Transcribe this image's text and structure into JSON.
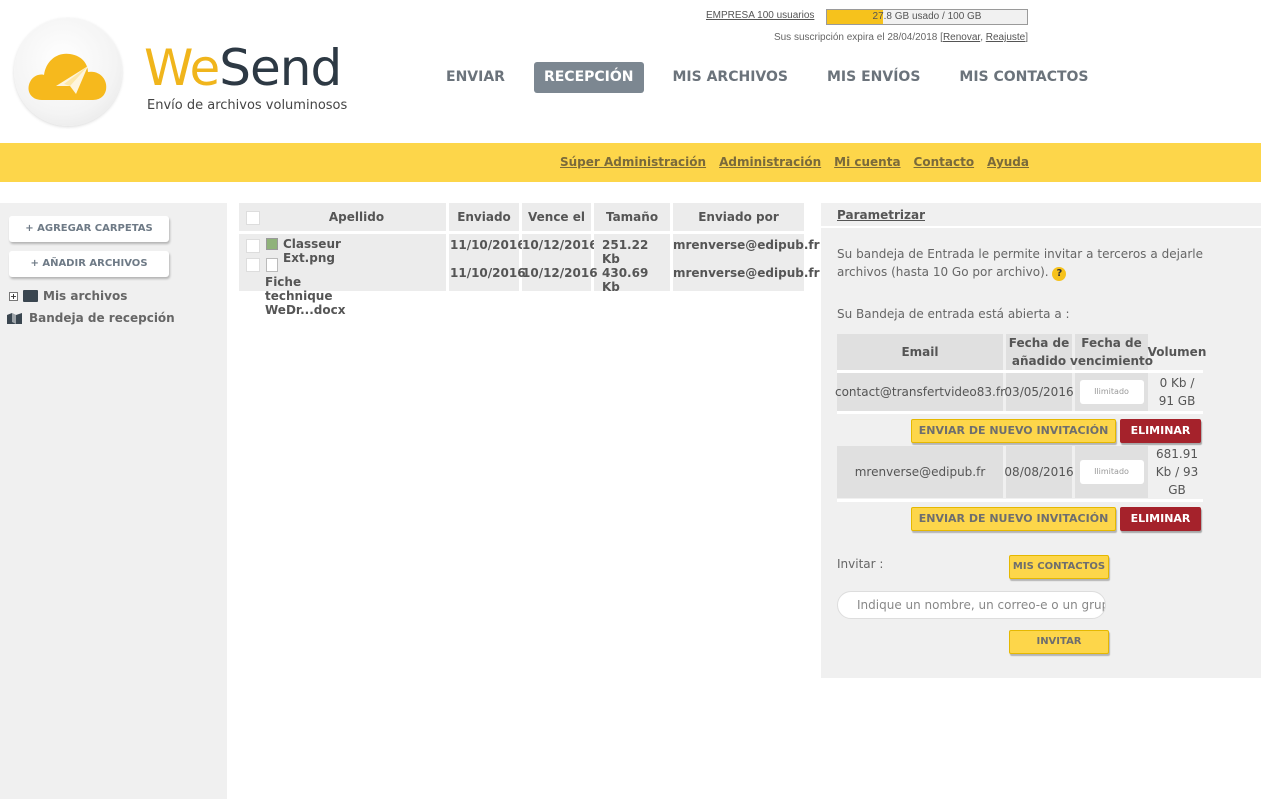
{
  "brand": {
    "name_part1": "We",
    "name_part2": "Send",
    "tagline": "Envío de archivos voluminosos"
  },
  "quota": {
    "label": "EMPRESA 100 usuarios",
    "text": "27.8 GB usado / 100 GB",
    "used_fraction": 0.278
  },
  "subscription": {
    "text": "Sus suscripción expira el 28/04/2018 [",
    "renew": "Renovar",
    "comma": ",",
    "readjust": "Reajuste",
    "close": "]"
  },
  "nav": {
    "items": [
      "ENVIAR",
      "RECEPCIÓN",
      "MIS ARCHIVOS",
      "MIS ENVÍOS",
      "MIS CONTACTOS"
    ],
    "active": "RECEPCIÓN"
  },
  "band_links": [
    "Súper Administración",
    "Administración",
    "Mi cuenta",
    "Contacto",
    "Ayuda"
  ],
  "sidebar": {
    "add_folders": "+ AGREGAR CARPETAS",
    "add_files": "+ AÑADIR ARCHIVOS",
    "tree": [
      "Mis archivos",
      "Bandeja de recepción"
    ]
  },
  "files": {
    "headers": [
      "Apellido",
      "Enviado el",
      "Vence el",
      "Tamaño",
      "Enviado por"
    ],
    "rows": [
      {
        "name": "Classeur Ext.png",
        "sent": "11/10/2016",
        "expires": "10/12/2016",
        "size": "251.22 Kb",
        "by": "mrenverse@edipub.fr"
      },
      {
        "name": "Fiche technique WeDr...docx",
        "sent": "11/10/2016",
        "expires": "10/12/2016",
        "size": "430.69 Kb",
        "by": "mrenverse@edipub.fr"
      }
    ]
  },
  "panel": {
    "tab": "Parametrizar",
    "description": "Su bandeja de Entrada le permite invitar a terceros a dejarle archivos (hasta 10 Go por archivo).",
    "help": "?",
    "open_to": "Su Bandeja de entrada está abierta a :",
    "headers": {
      "email": "Email",
      "added": "Fecha de añadido",
      "expiry": "Fecha de vencimiento",
      "volume": "Volumen"
    },
    "rows": [
      {
        "email": "contact@transfertvideo83.fr",
        "added": "03/05/2016",
        "expiry": "Ilimitado",
        "volume": "0 Kb / 91 GB"
      },
      {
        "email": "mrenverse@edipub.fr",
        "added": "08/08/2016",
        "expiry": "Ilimitado",
        "volume": "681.91 Kb / 93 GB"
      }
    ],
    "resend": "ENVIAR DE NUEVO INVITACIÓN",
    "delete": "ELIMINAR",
    "invite_label": "Invitar :",
    "contacts_btn": "MIS CONTACTOS",
    "invite_placeholder": "Indique un nombre, un correo-e o un grupo",
    "invite_btn": "INVITAR"
  },
  "colors": {
    "accent": "#fdd64a",
    "danger": "#a5222b",
    "nav_active": "#7c8791"
  }
}
